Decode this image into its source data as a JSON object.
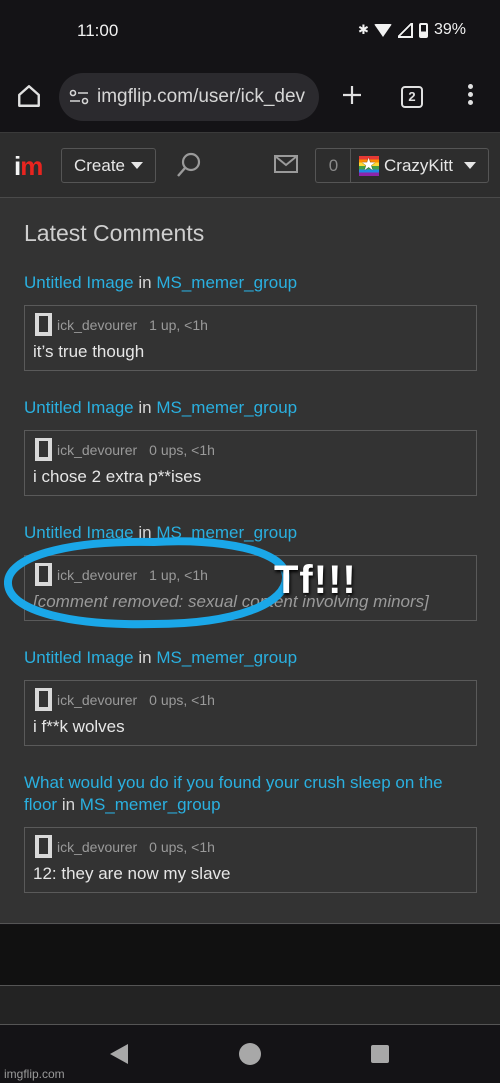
{
  "status_bar": {
    "time": "11:00",
    "battery": "39%"
  },
  "browser": {
    "url": "imgflip.com/user/ick_dev",
    "tab_count": "2"
  },
  "site_nav": {
    "logo_i": "i",
    "logo_m": "m",
    "create_label": "Create",
    "notification_count": "0",
    "username": "CrazyKitt"
  },
  "section_title": "Latest Comments",
  "connector": "in",
  "comments": [
    {
      "post_title": "Untitled Image",
      "group": "MS_memer_group",
      "author": "ick_devourer",
      "meta": "1 up, <1h",
      "text": "it’s true though"
    },
    {
      "post_title": "Untitled Image",
      "group": "MS_memer_group",
      "author": "ick_devourer",
      "meta": "0 ups, <1h",
      "text": "i chose 2 extra p**ises"
    },
    {
      "post_title": "Untitled Image",
      "group": "MS_memer_group",
      "author": "ick_devourer",
      "meta": "1 up, <1h",
      "text": "[comment removed: sexual content involving minors]"
    },
    {
      "post_title": "Untitled Image",
      "group": "MS_memer_group",
      "author": "ick_devourer",
      "meta": "0 ups, <1h",
      "text": "i f**k wolves"
    },
    {
      "post_title": "What would you do if you found your crush sleep on the floor",
      "group": "MS_memer_group",
      "author": "ick_devourer",
      "meta": "0 ups, <1h",
      "text": "12: they are now my slave"
    }
  ],
  "annotation": {
    "text": "Tf!!!",
    "color": "#1aa7e8"
  },
  "watermark": "imgflip.com",
  "colors": {
    "link": "#2ab0e0",
    "logo_red": "#e8241f",
    "page_bg": "#333333",
    "nav_bg": "#2d2d2d"
  }
}
